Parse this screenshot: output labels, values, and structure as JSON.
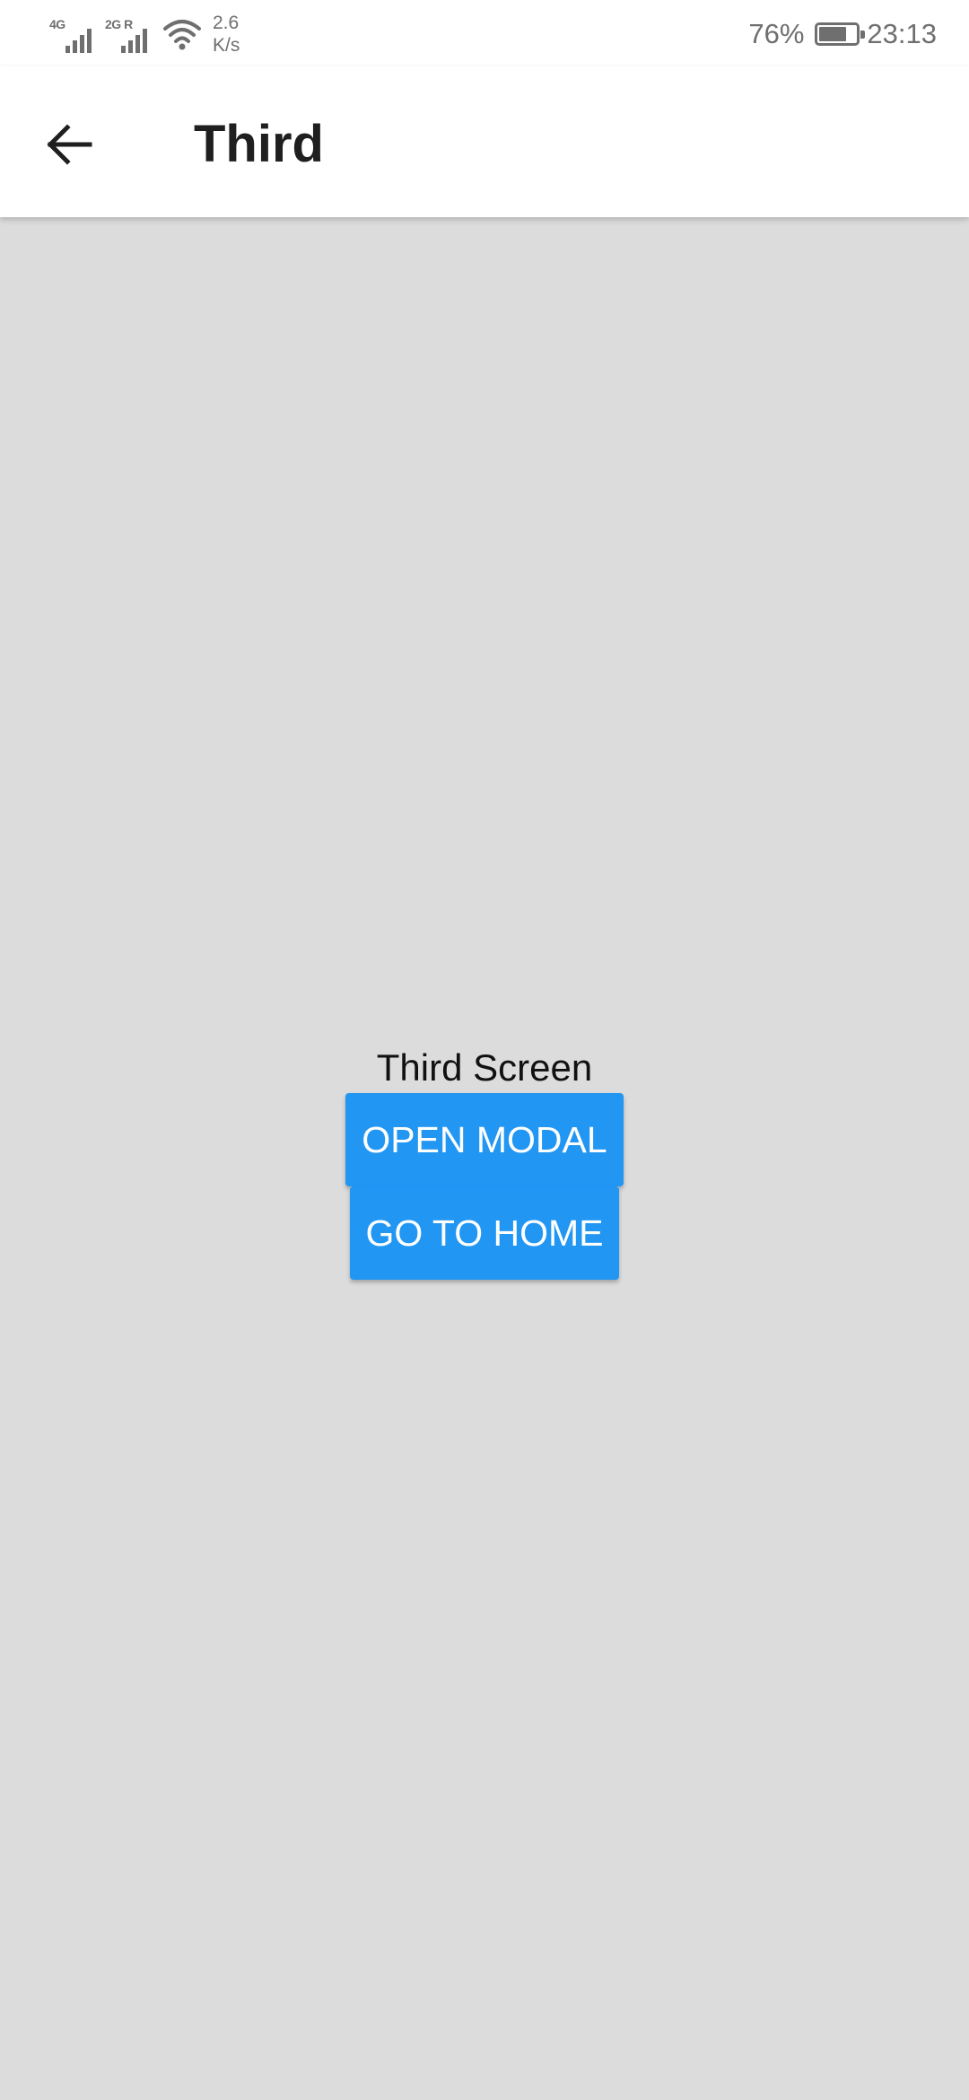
{
  "status_bar": {
    "network1": "4G",
    "network2": "2G R",
    "speed_value": "2.6",
    "speed_unit": "K/s",
    "battery_percent": "76%",
    "battery_level": 0.76,
    "time": "23:13"
  },
  "app_bar": {
    "back_icon": "arrow-left-icon",
    "title": "Third"
  },
  "content": {
    "screen_label": "Third Screen",
    "open_modal_label": "OPEN MODAL",
    "go_home_label": "GO TO HOME"
  },
  "colors": {
    "primary": "#2196f3",
    "background": "#dcdcdd",
    "appbar": "#ffffff"
  }
}
